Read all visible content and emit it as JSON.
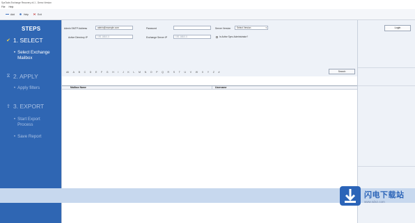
{
  "window": {
    "title": "SysTools Exchange Recovery v4.1 - Demo Version"
  },
  "menu": {
    "items": [
      "File",
      "Help"
    ]
  },
  "toolbar": {
    "items": [
      {
        "label": "Add",
        "icon": "add-icon"
      },
      {
        "label": "Help",
        "icon": "help-icon"
      },
      {
        "label": "Exit",
        "icon": "exit-icon"
      }
    ]
  },
  "sidebar": {
    "title": "STEPS",
    "step1": {
      "label": "1. SELECT",
      "icon": "check-icon",
      "sub": [
        "Select Exchange",
        "Mailbox"
      ]
    },
    "step2": {
      "label": "2. APPLY",
      "icon": "filter-icon",
      "sub": "Apply filters"
    },
    "step3": {
      "label": "3. EXPORT",
      "icon": "export-icon",
      "sub1": [
        "Start Export",
        "Process"
      ],
      "sub2": "Save Report"
    }
  },
  "form": {
    "smtp_label": "Admin SMTP Address",
    "smtp_value": "admin@example.com",
    "password_label": "Password",
    "password_value": "",
    "server_label": "Server Version",
    "server_value": "Select Version",
    "active_dir_label": "Active Directory IP",
    "active_dir_value": "192.168.0.0",
    "exchange_ip_label": "Exchange Server IP",
    "exchange_ip_value": "192.168.0.0",
    "checkbox_label": "Is Active Sync Administrator?"
  },
  "alphabet": [
    "All",
    "A",
    "B",
    "C",
    "D",
    "E",
    "F",
    "G",
    "H",
    "I",
    "J",
    "K",
    "L",
    "M",
    "N",
    "O",
    "P",
    "Q",
    "R",
    "S",
    "T",
    "U",
    "V",
    "W",
    "X",
    "Y",
    "Z",
    "#"
  ],
  "search_label": "Search",
  "grid": {
    "col1": "Mailbox Name",
    "col2": "Username"
  },
  "login_label": "Login",
  "watermark": {
    "title": "闪电下载站",
    "site": "www.sdxz.com"
  },
  "colors": {
    "sidebar": "#2f66b3",
    "accent": "#2b64b8",
    "strip": "#c7d8ee"
  }
}
